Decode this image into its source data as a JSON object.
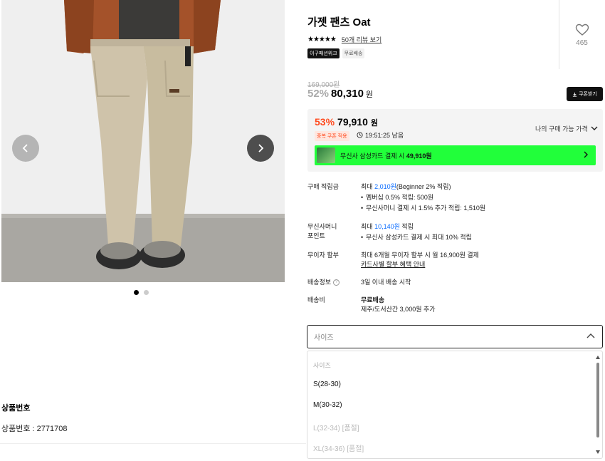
{
  "product": {
    "title": "가젯 팬츠 Oat",
    "stars": "★★★★★",
    "review_link": "50개 리뷰 보기",
    "badges": [
      "이구패션위크",
      "무료배송"
    ],
    "like_count": "465",
    "original_price": "169,000원",
    "discount": "52%",
    "price": "80,310",
    "won": "원",
    "coupon_button": "쿠폰받기"
  },
  "best_price": {
    "discount": "53%",
    "price": "79,910",
    "won": "원",
    "coupon_tag": "중복 쿠폰 적용",
    "timer": "19:51:25 남음",
    "my_price_label": "나의 구매 가능 가격",
    "card_banner_prefix": "무신사 삼성카드 결제 시",
    "card_banner_price": "49,910원"
  },
  "details": {
    "points_label": "구매 적립금",
    "points_prefix": "최대",
    "points_amount": "2,010원",
    "points_suffix": "(Beginner 2% 적립)",
    "points_bullet_1": "멤버십 0.5% 적립: 500원",
    "points_bullet_2": "무신사머니 결제 시 1.5% 추가 적립: 1,510원",
    "musinsa_label_1": "무신사머니",
    "musinsa_label_2": "포인트",
    "musinsa_prefix": "최대",
    "musinsa_amount": "10,140원",
    "musinsa_suffix": "적립",
    "musinsa_bullet": "무신사 삼성카드 결제 시 최대 10% 적립",
    "installment_label": "무이자 할부",
    "installment_text": "최대 6개월 무이자 할부 시 월 16,900원 결제",
    "installment_link": "카드사별 할부 혜택 안내",
    "shipping_info_label": "배송정보",
    "shipping_info_help": "?",
    "shipping_info_value": "3일 이내 배송 시작",
    "shipping_fee_label": "배송비",
    "shipping_fee_value": "무료배송",
    "shipping_fee_note": "제주/도서산간 3,000원 추가"
  },
  "size_select": {
    "placeholder": "사이즈",
    "options": [
      {
        "label": "사이즈",
        "state": "header"
      },
      {
        "label": "S(28-30)",
        "state": "enabled"
      },
      {
        "label": "M(30-32)",
        "state": "enabled"
      },
      {
        "label": "L(32-34) [품절]",
        "state": "disabled"
      },
      {
        "label": "XL(34-36) [품절]",
        "state": "disabled"
      }
    ]
  },
  "product_info": {
    "title": "상품번호",
    "row": "상품번호 : 2771708"
  },
  "gallery": {
    "current_index": 1,
    "total": 2
  },
  "colors": {
    "accent_red": "#ff4b1f",
    "link_blue": "#0a6cff",
    "banner_green": "#21ff3a",
    "pants_color": "#cfc3aa",
    "jacket_color": "#a4522a"
  },
  "icons": {
    "like": "heart-outline-icon",
    "prev": "chevron-left-icon",
    "next": "chevron-right-icon",
    "timer": "clock-icon",
    "coupon": "download-icon",
    "dropdown": "chevron-up-icon"
  }
}
